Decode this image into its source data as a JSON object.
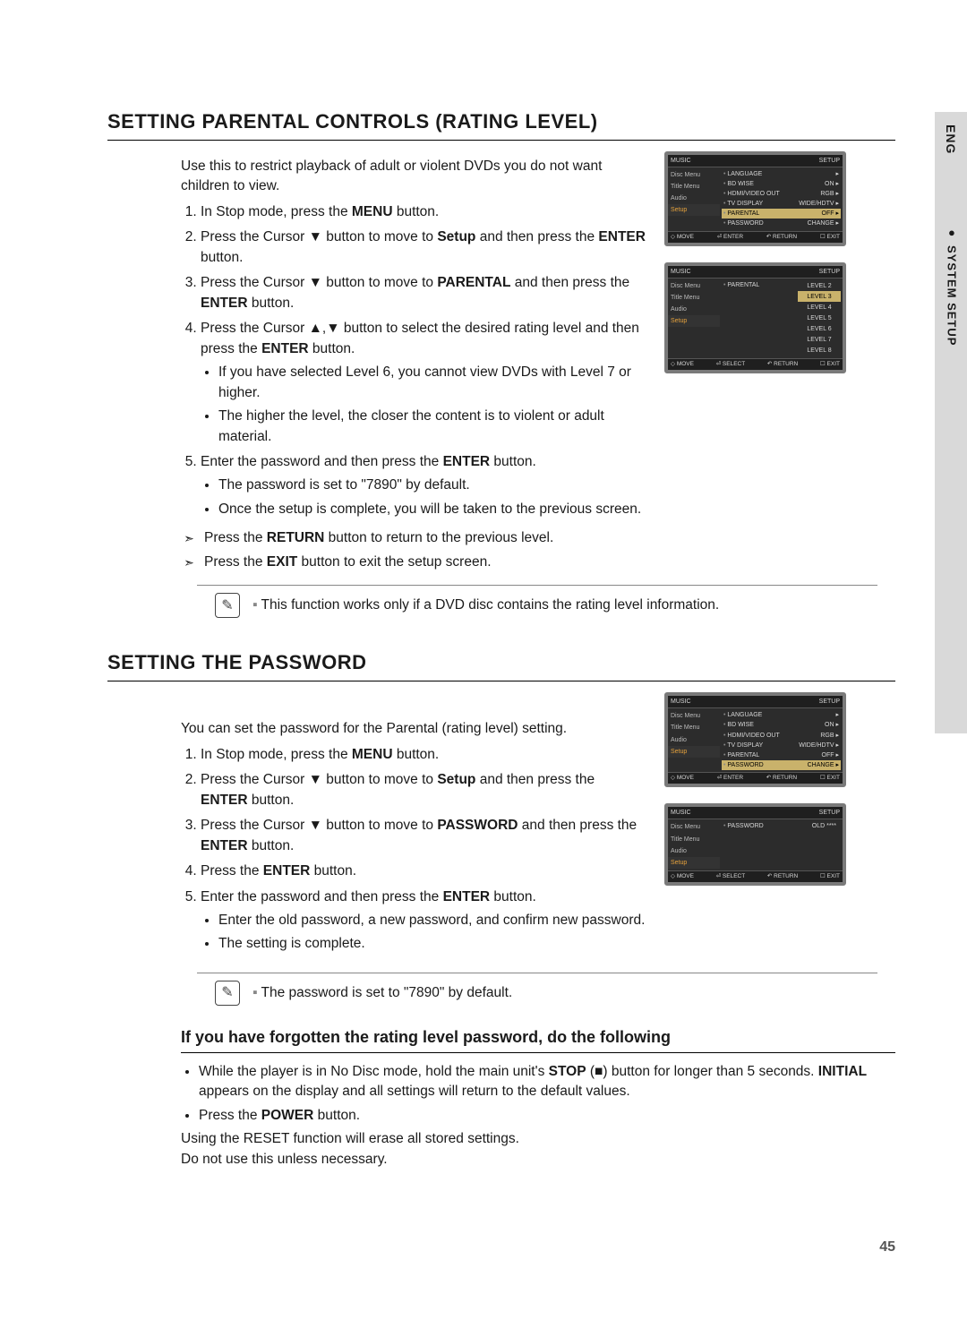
{
  "sideTab": {
    "lang": "ENG",
    "section": "SYSTEM SETUP",
    "bullet": "●"
  },
  "pageNumber": "45",
  "s1": {
    "title": "SETTING PARENTAL CONTROLS (RATING LEVEL)",
    "intro": "Use this to restrict playback of adult or violent DVDs you do not want children to view.",
    "step1_a": "In Stop mode, press the ",
    "step1_b": "MENU",
    "step1_c": " button.",
    "step2_a": "Press the Cursor ▼ button to move to ",
    "step2_b": "Setup",
    "step2_c": " and then press the ",
    "step2_d": "ENTER",
    "step2_e": " button.",
    "step3_a": "Press the Cursor ▼ button to move to ",
    "step3_b": "PARENTAL",
    "step3_c": " and then press the ",
    "step3_d": "ENTER",
    "step3_e": " button.",
    "step4_a": "Press the Cursor ▲,▼ button to select the desired rating level and then press the ",
    "step4_b": "ENTER",
    "step4_c": " button.",
    "step4_s1": "If you have selected Level 6, you cannot view DVDs with Level 7 or higher.",
    "step4_s2": "The higher the level, the closer the content is to violent or adult material.",
    "step5_a": "Enter the password and then press the ",
    "step5_b": "ENTER",
    "step5_c": " button.",
    "step5_s1": "The password is set to \"7890\" by default.",
    "step5_s2": "Once the setup is complete, you will be taken to the previous screen.",
    "ret_a": "Press the ",
    "ret_b": "RETURN",
    "ret_c": " button to return to the previous level.",
    "exit_a": "Press the ",
    "exit_b": "EXIT",
    "exit_c": " button to exit the setup screen.",
    "note": "This function works only if a DVD disc contains the rating level information."
  },
  "s2": {
    "title": "SETTING THE PASSWORD",
    "intro": "You can set the password for the Parental (rating level) setting.",
    "step1_a": "In Stop mode, press the ",
    "step1_b": "MENU",
    "step1_c": " button.",
    "step2_a": "Press the Cursor ▼ button to move to ",
    "step2_b": "Setup",
    "step2_c": " and then press the",
    "step2_d": "ENTER",
    "step2_e": " button.",
    "step3_a": "Press the Cursor ▼ button to move to ",
    "step3_b": "PASSWORD",
    "step3_c": " and then press the ",
    "step3_d": "ENTER",
    "step3_e": " button.",
    "step4_a": "Press the ",
    "step4_b": "ENTER",
    "step4_c": " button.",
    "step5_a": "Enter the password and then press the ",
    "step5_b": "ENTER",
    "step5_c": " button.",
    "step5_s1": "Enter the old password, a new password, and confirm new password.",
    "step5_s2": "The setting is complete.",
    "note": "The password is set to \"7890\" by default."
  },
  "s3": {
    "title": "If you have forgotten the rating level password, do the following",
    "b1_a": "While the player is in No Disc mode, hold the main unit's ",
    "b1_b": "STOP",
    "b1_c": " (■) button for longer than 5 seconds. ",
    "b1_d": "INITIAL",
    "b1_e": " appears on the display and all settings will return to the default values.",
    "b2_a": "Press the ",
    "b2_b": "POWER",
    "b2_c": " button.",
    "l1": "Using the RESET function will erase all stored settings.",
    "l2": "Do not use this unless necessary."
  },
  "osdNav": {
    "header": "MUSIC",
    "br": "SETUP",
    "discMenu": "Disc Menu",
    "titleMenu": "Title Menu",
    "audio": "Audio",
    "setup": "Setup"
  },
  "osdFoot": {
    "move": "MOVE",
    "enter": "ENTER",
    "select": "SELECT",
    "ret": "RETURN",
    "exit": "EXIT"
  },
  "osd1": {
    "language": "LANGUAGE",
    "bdwise": "BD WISE",
    "bdwise_v": "ON",
    "hdmi": "HDMI/VIDEO OUT",
    "hdmi_v": "RGB",
    "tvdisp": "TV DISPLAY",
    "tvdisp_v": "WIDE/HDTV",
    "parental": "PARENTAL",
    "parental_v": "OFF",
    "password": "PASSWORD",
    "password_v": "CHANGE"
  },
  "osd2": {
    "parental": "PARENTAL",
    "l2": "LEVEL 2",
    "l3": "LEVEL 3",
    "l4": "LEVEL 4",
    "l5": "LEVEL 5",
    "l6": "LEVEL 6",
    "l7": "LEVEL 7",
    "l8": "LEVEL 8"
  },
  "osd3": {
    "language": "LANGUAGE",
    "bdwise": "BD WISE",
    "bdwise_v": "ON",
    "hdmi": "HDMI/VIDEO OUT",
    "hdmi_v": "RGB",
    "tvdisp": "TV DISPLAY",
    "tvdisp_v": "WIDE/HDTV",
    "parental": "PARENTAL",
    "parental_v": "OFF",
    "password": "PASSWORD",
    "password_v": "CHANGE"
  },
  "osd4": {
    "password": "PASSWORD",
    "old": "OLD ****"
  }
}
